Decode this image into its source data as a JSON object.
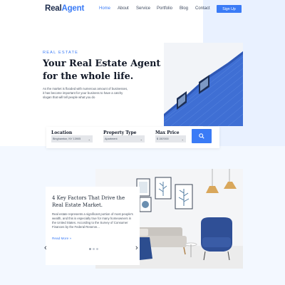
{
  "brand": {
    "prefix": "Real",
    "suffix": "Agent"
  },
  "nav": [
    "Home",
    "About",
    "Service",
    "Portfolio",
    "Blog",
    "Contact"
  ],
  "signup_label": "Sign Up",
  "hero": {
    "eyebrow": "REAL ESTATE",
    "title": "Your Real Estate Agent for the whole life.",
    "description": "As the market is flooded with numerous amount of businesses, it has become important for your business to have a catchy slogan that will tell people what you do"
  },
  "search": {
    "location_label": "Location",
    "location_value": "Binghamton, NY 13905",
    "type_label": "Property Type",
    "type_value": "Apartment",
    "price_label": "Max Price",
    "price_value": "$ 150'000"
  },
  "feature": {
    "title": "4 Key Factors That Drive the Real Estate Market.",
    "description": "Real estate represents a significant portion of most people's wealth, and this is especially true for many homeowners in the United States. According to the Survey of Consumer Finances by the Federal Reserve...",
    "link": "Read More »"
  },
  "colors": {
    "accent": "#3a7bf6",
    "building": "#3f6fd4"
  },
  "icons": {
    "search": "search-icon",
    "prev": "chevron-left-icon",
    "next": "chevron-right-icon"
  }
}
